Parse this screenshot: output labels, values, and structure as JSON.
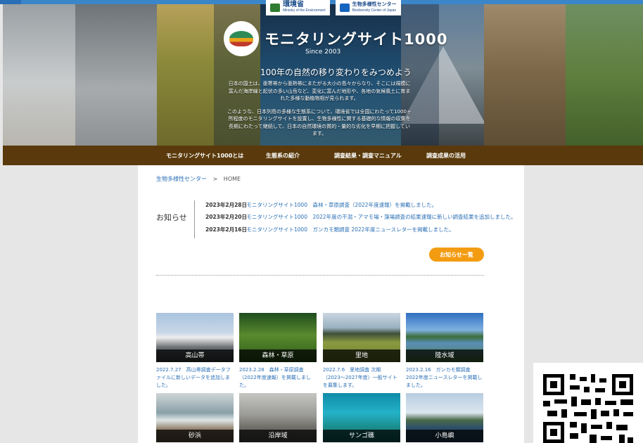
{
  "site": {
    "title": "モニタリングサイト1000",
    "since": "Since 2003",
    "tagline": "100年の自然の移り変わりをみつめよう",
    "intro_1": "日本の国土は、亜寒帯から亜熱帯にまたがる大小の島々からなり、そこには規模に富んだ海岸線と起伏の多い山岳など、変化に富んだ地形や、各地の気候風土に育まれた多様な動植物相が見られます。",
    "intro_2": "このような、日本列島の多様な生態系について、環境省では全国にわたって1000ヶ所程度のモニタリングサイトを設置し、生物多様性に関する基礎的な情報の収集を長期にわたって継続して、日本の自然環境の質的・量的な劣化を早期に把握しています。",
    "agency_1": "環境省",
    "agency_1_sub": "Ministry of the Environment",
    "agency_2": "生物多様性センター",
    "agency_2_sub": "Biodiversity Center of Japan"
  },
  "nav": {
    "items": [
      {
        "label": "モニタリングサイト1000とは"
      },
      {
        "label": "生態系の紹介"
      },
      {
        "label": "調査結果・調査マニュアル"
      },
      {
        "label": "調査成果の活用"
      }
    ]
  },
  "breadcrumb": {
    "home_link": "生物多様性センター",
    "separator": ">",
    "current": "HOME"
  },
  "news": {
    "heading": "お知らせ",
    "items": [
      {
        "date": "2023年2月28日",
        "text": "モニタリングサイト1000　森林・草原調査（2022年度速報）を掲載しました。"
      },
      {
        "date": "2023年2月20日",
        "text": "モニタリングサイト1000　2022年度の干潟・アマモ場・藻場調査の結果速報に新しい調査結果を追加しました。"
      },
      {
        "date": "2023年2月16日",
        "text": "モニタリングサイト1000　ガンカモ類調査 2022年度ニュースレターを掲載しました。"
      }
    ],
    "more_label": "お知らせ一覧"
  },
  "ecosystems": {
    "tiles": [
      {
        "label": "高山帯",
        "caption": "2022.7.27　高山帯調査データファイルに新しいデータを追加しました。"
      },
      {
        "label": "森林・草原",
        "caption": "2023.2.28　森林・草原調査（2022年度速報）を掲載しました。"
      },
      {
        "label": "里地",
        "caption": "2022.7.6　里地調査 次期（2023〜2027年度）一般サイトを募集します。"
      },
      {
        "label": "陸水域",
        "caption": "2023.2.16　ガンカモ類調査 2022年度ニュースレターを掲載しました。"
      },
      {
        "label": "砂浜",
        "caption": ""
      },
      {
        "label": "沿岸域",
        "caption": ""
      },
      {
        "label": "サンゴ礁",
        "caption": ""
      },
      {
        "label": "小島嶼",
        "caption": ""
      }
    ]
  },
  "colors": {
    "nav_bg": "#5a3a0c",
    "link": "#2a6fb6",
    "button": "#f39c12",
    "top_strip": "#2a6fb6"
  },
  "icons": {
    "logo": "monitoring-site-logo-icon",
    "qr": "qr-code-icon"
  }
}
